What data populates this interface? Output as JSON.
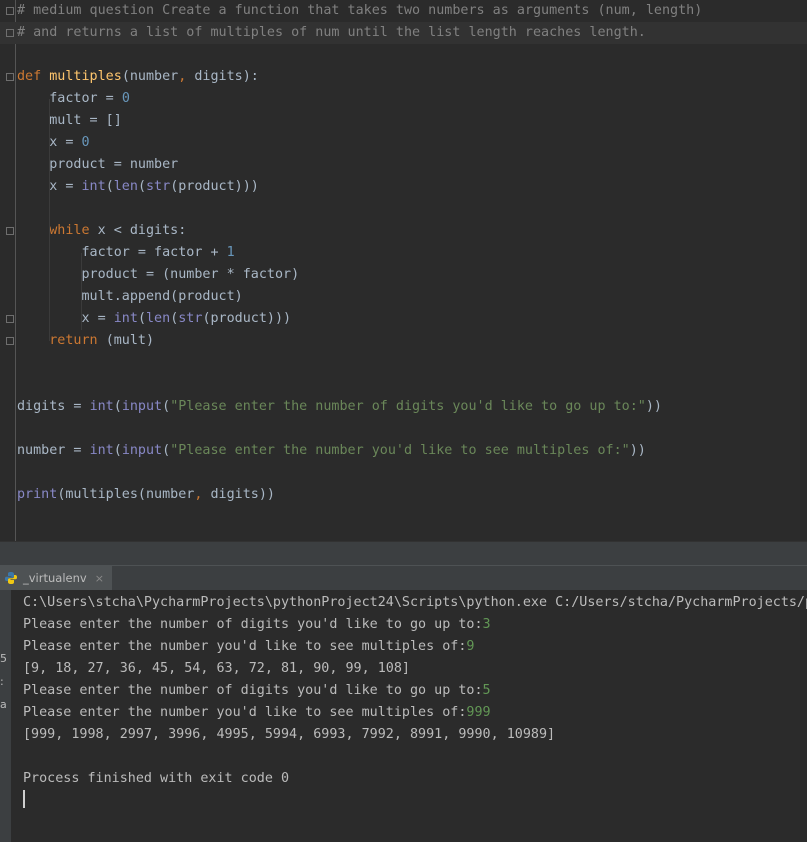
{
  "editor": {
    "lines": [
      {
        "tokens": [
          {
            "c": "cm",
            "t": "# medium question Create a function that takes two numbers as arguments (num, length)"
          }
        ]
      },
      {
        "tokens": [
          {
            "c": "cm",
            "t": "# and returns a list of multiples of num until the list length reaches length."
          }
        ]
      },
      {
        "tokens": []
      },
      {
        "tokens": [
          {
            "c": "kw",
            "t": "def "
          },
          {
            "c": "fn",
            "t": "multiples"
          },
          {
            "c": "",
            "t": "(number"
          },
          {
            "c": "kw",
            "t": ", "
          },
          {
            "c": "",
            "t": "digits):"
          }
        ]
      },
      {
        "tokens": [
          {
            "c": "",
            "t": "    factor = "
          },
          {
            "c": "num",
            "t": "0"
          }
        ]
      },
      {
        "tokens": [
          {
            "c": "",
            "t": "    mult = []"
          }
        ]
      },
      {
        "tokens": [
          {
            "c": "",
            "t": "    x = "
          },
          {
            "c": "num",
            "t": "0"
          }
        ]
      },
      {
        "tokens": [
          {
            "c": "",
            "t": "    product = number"
          }
        ]
      },
      {
        "tokens": [
          {
            "c": "",
            "t": "    x = "
          },
          {
            "c": "bi",
            "t": "int"
          },
          {
            "c": "",
            "t": "("
          },
          {
            "c": "bi",
            "t": "len"
          },
          {
            "c": "",
            "t": "("
          },
          {
            "c": "bi",
            "t": "str"
          },
          {
            "c": "",
            "t": "(product)))"
          }
        ]
      },
      {
        "tokens": []
      },
      {
        "tokens": [
          {
            "c": "kw",
            "t": "    while "
          },
          {
            "c": "",
            "t": "x < digits:"
          }
        ]
      },
      {
        "tokens": [
          {
            "c": "",
            "t": "        factor = factor + "
          },
          {
            "c": "num",
            "t": "1"
          }
        ]
      },
      {
        "tokens": [
          {
            "c": "",
            "t": "        product = (number * factor)"
          }
        ]
      },
      {
        "tokens": [
          {
            "c": "",
            "t": "        mult.append(product)"
          }
        ]
      },
      {
        "tokens": [
          {
            "c": "",
            "t": "        x = "
          },
          {
            "c": "bi",
            "t": "int"
          },
          {
            "c": "",
            "t": "("
          },
          {
            "c": "bi",
            "t": "len"
          },
          {
            "c": "",
            "t": "("
          },
          {
            "c": "bi",
            "t": "str"
          },
          {
            "c": "",
            "t": "(product)))"
          }
        ]
      },
      {
        "tokens": [
          {
            "c": "kw",
            "t": "    return "
          },
          {
            "c": "",
            "t": "(mult)"
          }
        ]
      },
      {
        "tokens": []
      },
      {
        "tokens": []
      },
      {
        "tokens": [
          {
            "c": "",
            "t": "digits = "
          },
          {
            "c": "bi",
            "t": "int"
          },
          {
            "c": "",
            "t": "("
          },
          {
            "c": "bi",
            "t": "input"
          },
          {
            "c": "",
            "t": "("
          },
          {
            "c": "str",
            "t": "\"Please enter the number of digits you'd like to go up to:\""
          },
          {
            "c": "",
            "t": "))"
          }
        ]
      },
      {
        "tokens": []
      },
      {
        "tokens": [
          {
            "c": "",
            "t": "number = "
          },
          {
            "c": "bi",
            "t": "int"
          },
          {
            "c": "",
            "t": "("
          },
          {
            "c": "bi",
            "t": "input"
          },
          {
            "c": "",
            "t": "("
          },
          {
            "c": "str",
            "t": "\"Please enter the number you'd like to see multiples of:\""
          },
          {
            "c": "",
            "t": "))"
          }
        ]
      },
      {
        "tokens": []
      },
      {
        "tokens": [
          {
            "c": "bi",
            "t": "print"
          },
          {
            "c": "",
            "t": "(multiples(number"
          },
          {
            "c": "kw",
            "t": ", "
          },
          {
            "c": "",
            "t": "digits))"
          }
        ]
      }
    ]
  },
  "run_tab": {
    "label": "_virtualenv",
    "close_symbol": "×"
  },
  "side_marks": [
    "5",
    ":",
    "a"
  ],
  "console": {
    "lines": [
      {
        "text": "C:\\Users\\stcha\\PycharmProjects\\pythonProject24\\Scripts\\python.exe C:/Users/stcha/PycharmProjects/p",
        "input": ""
      },
      {
        "text": "Please enter the number of digits you'd like to go up to:",
        "input": "3"
      },
      {
        "text": "Please enter the number you'd like to see multiples of:",
        "input": "9"
      },
      {
        "text": "[9, 18, 27, 36, 45, 54, 63, 72, 81, 90, 99, 108]",
        "input": ""
      },
      {
        "text": "Please enter the number of digits you'd like to go up to:",
        "input": "5"
      },
      {
        "text": "Please enter the number you'd like to see multiples of:",
        "input": "999"
      },
      {
        "text": "[999, 1998, 2997, 3996, 4995, 5994, 6993, 7992, 8991, 9990, 10989]",
        "input": ""
      },
      {
        "text": "",
        "input": ""
      },
      {
        "text": "Process finished with exit code 0",
        "input": ""
      }
    ]
  },
  "colors": {
    "background": "#2b2b2b",
    "keyword": "#cc7832",
    "function": "#ffc66d",
    "number": "#6897bb",
    "comment": "#808080",
    "string": "#6a8759",
    "builtin": "#8888c6",
    "user_input": "#629755"
  }
}
